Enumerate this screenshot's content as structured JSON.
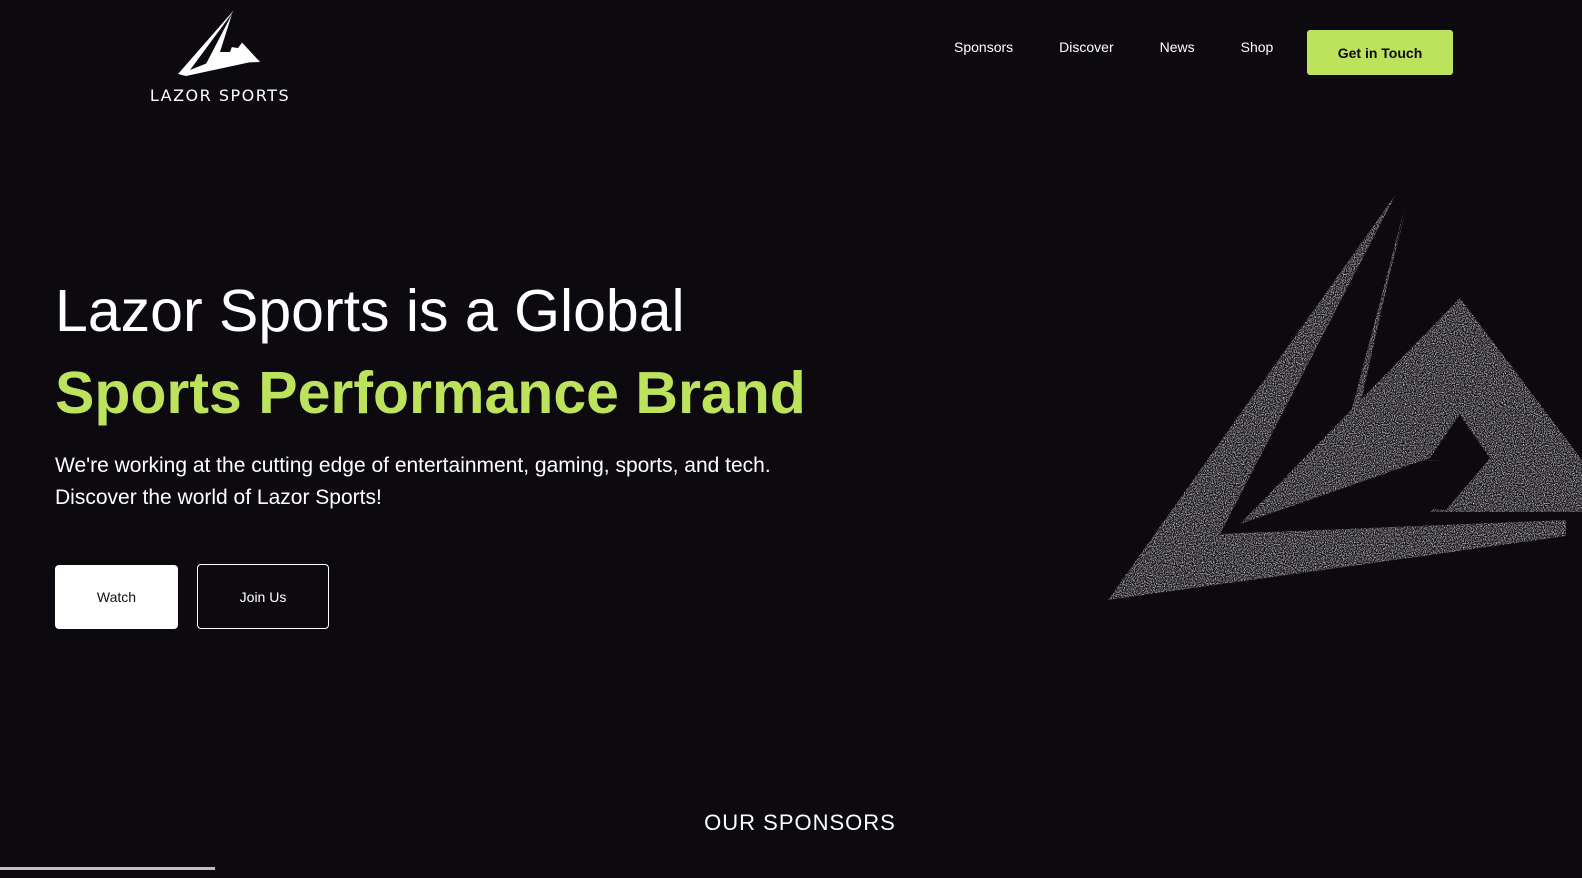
{
  "brand": {
    "name": "LAZOR SPORTS"
  },
  "nav": {
    "items": [
      {
        "label": "Sponsors"
      },
      {
        "label": "Discover"
      },
      {
        "label": "News"
      },
      {
        "label": "Shop"
      }
    ],
    "cta_label": "Get in Touch"
  },
  "hero": {
    "title": "Lazor Sports is a Global",
    "accent": "Sports Performance Brand",
    "description_line1": "We're working at the cutting edge of entertainment, gaming, sports, and tech.",
    "description_line2": "Discover the world of Lazor Sports!",
    "watch_label": "Watch",
    "join_label": "Join Us"
  },
  "sponsors": {
    "title": "OUR SPONSORS"
  },
  "colors": {
    "background": "#0d0a0f",
    "accent": "#bde35d",
    "text": "#ffffff"
  }
}
